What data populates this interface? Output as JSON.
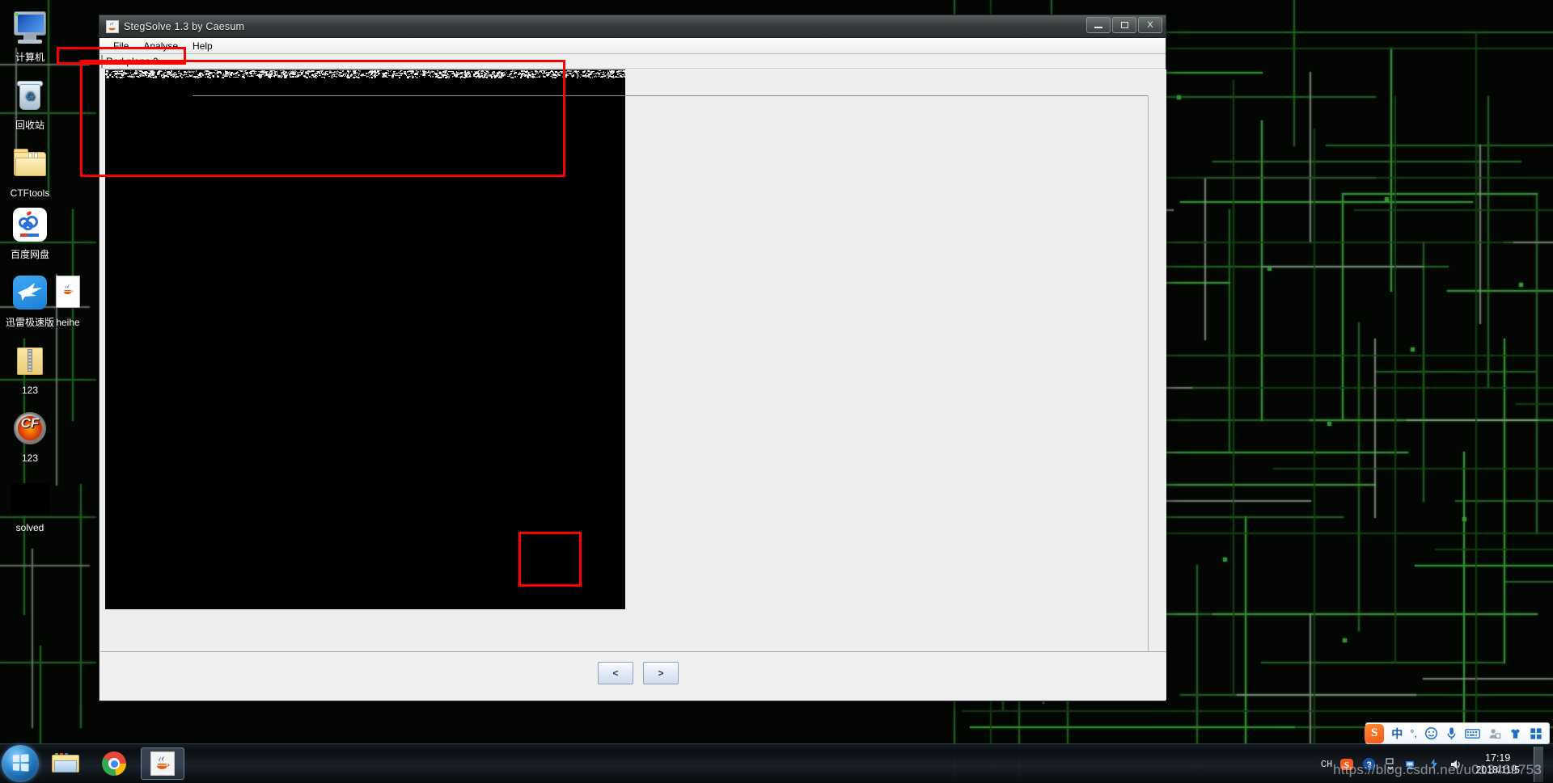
{
  "desktop": {
    "icons": [
      {
        "label": "计算机",
        "icon": "computer-icon",
        "name": "desktop-icon-computer"
      },
      {
        "label": "回收站",
        "icon": "recycle-bin-icon",
        "name": "desktop-icon-recycle-bin"
      },
      {
        "label": "CTFtools",
        "icon": "folder-icon",
        "name": "desktop-icon-ctftools"
      },
      {
        "label": "百度网盘",
        "icon": "baidu-netdisk-icon",
        "name": "desktop-icon-baidu-netdisk"
      },
      {
        "label": "迅雷极速版",
        "icon": "thunder-icon",
        "name": "desktop-icon-thunder"
      },
      {
        "label": "heihe",
        "icon": "java-file-icon",
        "name": "desktop-icon-heihe"
      },
      {
        "label": "123",
        "icon": "zip-folder-icon",
        "name": "desktop-icon-123-zip"
      },
      {
        "label": "123",
        "icon": "crossfire-game-icon",
        "name": "desktop-icon-123-crossfire"
      },
      {
        "label": "solved",
        "icon": "black-image-icon",
        "name": "desktop-icon-solved"
      }
    ]
  },
  "window": {
    "title": "StegSolve 1.3 by Caesum",
    "title_icon": "java-coffee-icon",
    "controls": {
      "minimize": "minimize-button",
      "maximize": "maximize-button",
      "close": "close-button",
      "close_glyph": "X"
    },
    "menu": [
      {
        "label": "File",
        "name": "menu-file"
      },
      {
        "label": "Analyse",
        "name": "menu-analyse"
      },
      {
        "label": "Help",
        "name": "menu-help"
      }
    ],
    "plane_label": "Red plane 0",
    "nav": {
      "prev_label": "<",
      "next_label": ">"
    }
  },
  "annotations": {
    "accent_color": "#fe0000",
    "boxes": [
      {
        "name": "annotation-plane-label",
        "target": "Red plane 0"
      },
      {
        "name": "annotation-image-region",
        "target": "image top region"
      },
      {
        "name": "annotation-next-button",
        "target": ">"
      }
    ]
  },
  "taskbar": {
    "start": "windows-start-orb",
    "items": [
      {
        "name": "taskbar-item-explorer",
        "icon": "file-explorer-icon",
        "active": false
      },
      {
        "name": "taskbar-item-chrome",
        "icon": "chrome-icon",
        "active": false
      },
      {
        "name": "taskbar-item-stegsolve",
        "icon": "java-coffee-icon",
        "active": true
      }
    ],
    "tray": {
      "input_method": "CH",
      "icons": [
        "sogou-pinyin-icon",
        "help-icon",
        "show-hidden-icons-icon",
        "network-icon",
        "action-center-icon",
        "volume-icon"
      ],
      "time": "17:19",
      "date": "2018/11/5"
    },
    "ime_bar": {
      "logo": "S",
      "mode": "中",
      "punctuation": "°,",
      "icons": [
        "smiley-icon",
        "microphone-icon",
        "keyboard-icon",
        "user-icon",
        "skin-icon",
        "toolbox-icon"
      ]
    }
  },
  "watermark": {
    "text": "https://blog.csdn.net/u013469753"
  }
}
